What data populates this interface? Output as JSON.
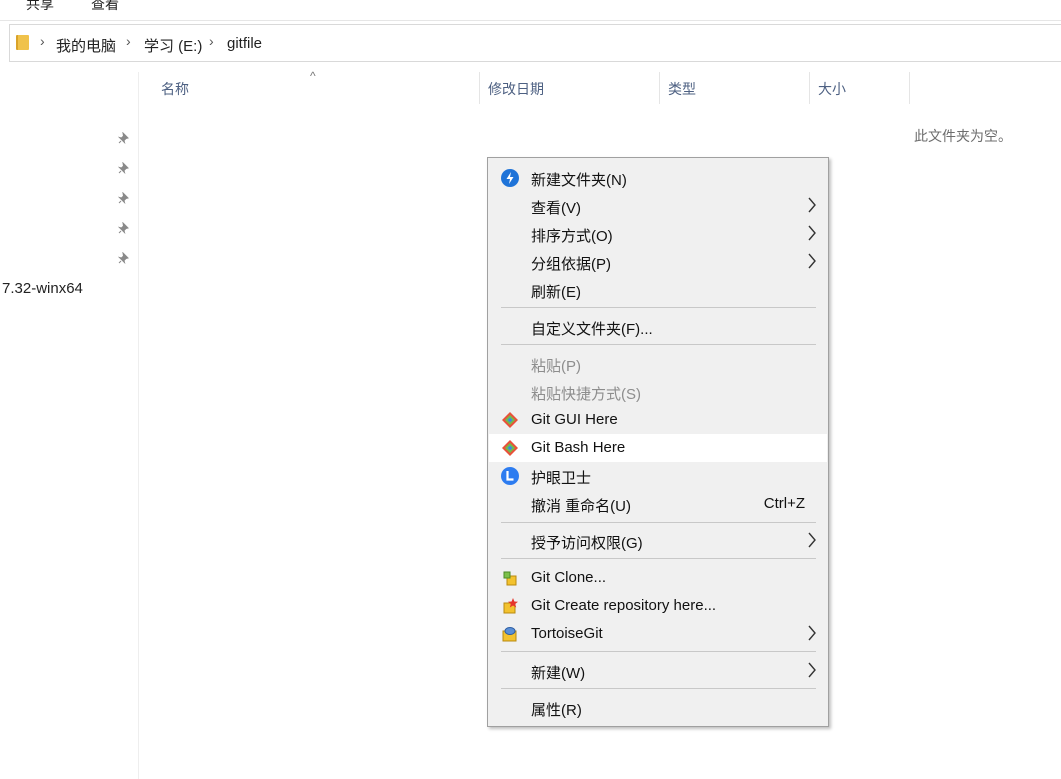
{
  "ribbon": {
    "tab_share": "共享",
    "tab_view": "查看"
  },
  "address": {
    "crumbs": [
      "我的电脑",
      "学习 (E:)",
      "gitfile"
    ]
  },
  "nav": {
    "partial_item": "7.32-winx64"
  },
  "columns": {
    "name": "名称",
    "date": "修改日期",
    "type": "类型",
    "size": "大小"
  },
  "empty_message": "此文件夹为空。",
  "menu": {
    "new_folder": "新建文件夹(N)",
    "view": "查看(V)",
    "sort_by": "排序方式(O)",
    "group_by": "分组依据(P)",
    "refresh": "刷新(E)",
    "customize": "自定义文件夹(F)...",
    "paste": "粘贴(P)",
    "paste_shortcut": "粘贴快捷方式(S)",
    "git_gui": "Git GUI Here",
    "git_bash": "Git Bash Here",
    "eye_guard": "护眼卫士",
    "undo_rename": "撤消 重命名(U)",
    "undo_shortcut": "Ctrl+Z",
    "grant_access": "授予访问权限(G)",
    "git_clone": "Git Clone...",
    "git_create_repo": "Git Create repository here...",
    "tortoisegit": "TortoiseGit",
    "new": "新建(W)",
    "properties": "属性(R)"
  }
}
